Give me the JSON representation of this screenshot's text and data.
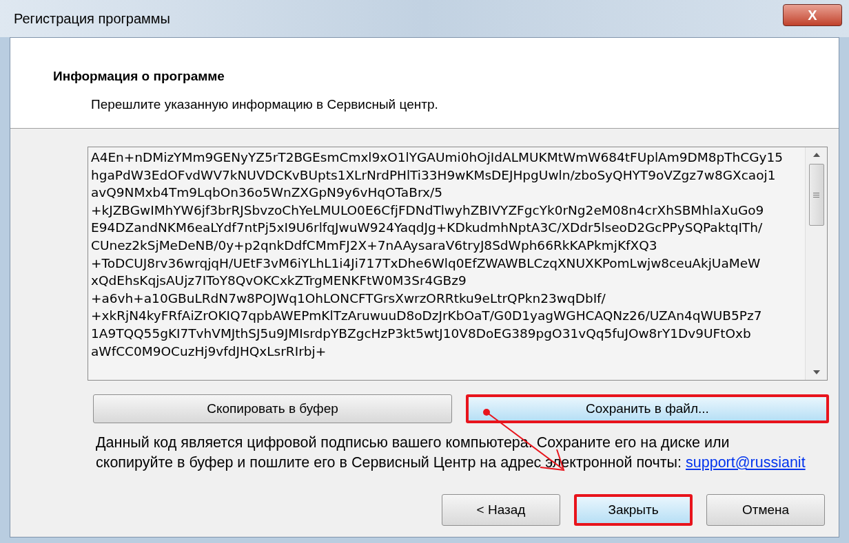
{
  "window": {
    "title": "Регистрация программы",
    "close_glyph": "X"
  },
  "header": {
    "title": "Информация о программе",
    "subtitle": "Перешлите указанную информацию в Сервисный центр."
  },
  "code_lines": [
    "A4En+nDMizYMm9GENyYZ5rT2BGEsmCmxl9xO1lYGAUmi0hOjIdALMUKMtWmW684tFUplAm9DM8pThCGy15",
    "hgaPdW3EdOFvdWV7kNUVDCKvBUpts1XLrNrdPHlTi33H9wKMsDEJHpgUwln/zboSyQHYT9oVZgz7w8GXcaoj1",
    "avQ9NMxb4Tm9LqbOn36o5WnZXGpN9y6vHqOTaBrx/5",
    "+kJZBGwIMhYW6jf3brRJSbvzoChYeLMULO0E6CfjFDNdTlwyhZBIVYZFgcYk0rNg2eM08n4crXhSBMhlaXuGo9",
    "E94DZandNKM6eaLYdf7ntPj5xI9U6rlfqJwuW924YaqdJg+KDkudmhNptA3C/XDdr5lseoD2GcPPySQPaktqITh/",
    "CUnez2kSjMeDeNB/0y+p2qnkDdfCMmFJ2X+7nAAysaraV6tryJ8SdWph66RkKAPkmjKfXQ3",
    "+ToDCUJ8rv36wrqjqH/UEtF3vM6iYLhL1i4Ji717TxDhe6Wlq0EfZWAWBLCzqXNUXKPomLwjw8ceuAkjUaMeW",
    "xQdEhsKqjsAUjz7IToY8QvOKCxkZTrgMENKFtW0M3Sr4GBz9",
    "+a6vh+a10GBuLRdN7w8POJWq1OhLONCFTGrsXwrzORRtku9eLtrQPkn23wqDbIf/",
    "+xkRjN4kyFRfAiZrOKIQ7qpbAWEPmKlTzAruwuuD8oDzJrKbOaT/G0D1yagWGHCAQNz26/UZAn4qWUB5Pz7",
    "1A9TQQ55gKI7TvhVMJthSJ5u9JMIsrdpYBZgcHzP3kt5wtJ10V8DoEG389pgO31vQq5fuJOw8rY1Dv9UFtOxb",
    "aWfCC0M9OCuzHj9vfdJHQxLsrRIrbj+"
  ],
  "action_buttons": [
    {
      "label": "Скопировать в буфер",
      "highlighted": false
    },
    {
      "label": "Сохранить в файл...",
      "highlighted": true
    }
  ],
  "note": {
    "lines": [
      "Данный код является цифровой подписью вашего компьютера. Сохраните его на диске или",
      "скопируйте в буфер и пошлите его в Сервисный Центр на адрес электронной почты:"
    ],
    "link": "support@russianit"
  },
  "footer_buttons": [
    {
      "label": "< Назад",
      "highlighted": false
    },
    {
      "label": "Закрыть",
      "highlighted": true
    },
    {
      "label": "Отмена",
      "highlighted": false
    }
  ]
}
